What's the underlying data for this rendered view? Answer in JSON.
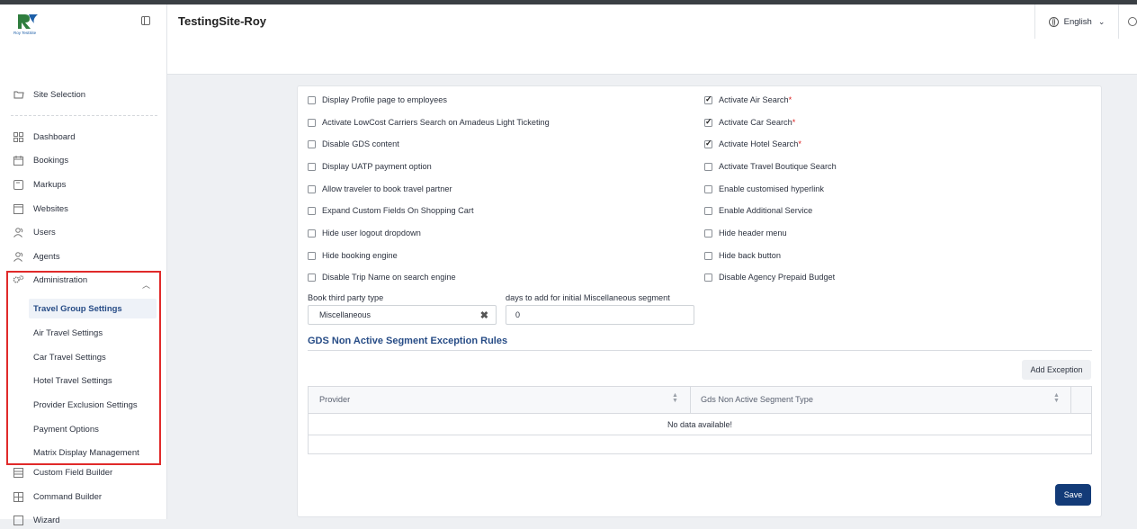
{
  "brand": {
    "logo_text": "Roy TestSite"
  },
  "header": {
    "site_title": "TestingSite-Roy",
    "language": "English"
  },
  "sidebar": {
    "site_selection": "Site Selection",
    "items": [
      {
        "label": "Dashboard",
        "icon": "grid-icon"
      },
      {
        "label": "Bookings",
        "icon": "calendar-icon"
      },
      {
        "label": "Markups",
        "icon": "tag-icon"
      },
      {
        "label": "Websites",
        "icon": "window-icon"
      },
      {
        "label": "Users",
        "icon": "users-icon"
      },
      {
        "label": "Agents",
        "icon": "agents-icon"
      }
    ],
    "administration": {
      "label": "Administration",
      "sub_items": [
        {
          "label": "Travel Group Settings",
          "active": true
        },
        {
          "label": "Air Travel Settings"
        },
        {
          "label": "Car Travel Settings"
        },
        {
          "label": "Hotel Travel Settings"
        },
        {
          "label": "Provider Exclusion Settings"
        },
        {
          "label": "Payment Options"
        },
        {
          "label": "Matrix Display Management"
        }
      ]
    },
    "bottom_items": [
      {
        "label": "Custom Field Builder"
      },
      {
        "label": "Command Builder"
      },
      {
        "label": "Wizard"
      }
    ]
  },
  "settings": {
    "left": [
      {
        "label": "Display Profile page to employees",
        "checked": false
      },
      {
        "label": "Activate LowCost Carriers Search on Amadeus Light Ticketing",
        "checked": false
      },
      {
        "label": "Disable GDS content",
        "checked": false
      },
      {
        "label": "Display UATP payment option",
        "checked": false
      },
      {
        "label": "Allow traveler to book travel partner",
        "checked": false
      },
      {
        "label": "Expand Custom Fields On Shopping Cart",
        "checked": false
      },
      {
        "label": "Hide user logout dropdown",
        "checked": false
      },
      {
        "label": "Hide booking engine",
        "checked": false
      },
      {
        "label": "Disable Trip Name on search engine",
        "checked": false
      }
    ],
    "right": [
      {
        "label": "Activate Air Search",
        "checked": true,
        "required": "*"
      },
      {
        "label": "Activate Car Search",
        "checked": true,
        "required": "*"
      },
      {
        "label": "Activate Hotel Search",
        "checked": true,
        "required": "*"
      },
      {
        "label": "Activate Travel Boutique Search",
        "checked": false
      },
      {
        "label": "Enable customised hyperlink",
        "checked": false
      },
      {
        "label": "Enable Additional Service",
        "checked": false
      },
      {
        "label": "Hide header menu",
        "checked": false
      },
      {
        "label": "Hide back button",
        "checked": false
      },
      {
        "label": "Disable Agency Prepaid Budget",
        "checked": false
      }
    ],
    "book_third_party": {
      "label": "Book third party type",
      "value": "Miscellaneous"
    },
    "days_to_add": {
      "label": "days to add for initial Miscellaneous segment",
      "value": "0"
    }
  },
  "gds_section": {
    "title": "GDS Non Active Segment Exception Rules",
    "add_button": "Add Exception",
    "columns": [
      "Provider",
      "Gds Non Active Segment Type"
    ],
    "empty_text": "No data available!"
  },
  "save_button": "Save"
}
